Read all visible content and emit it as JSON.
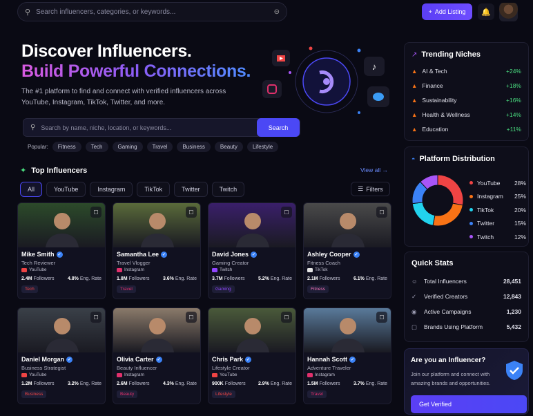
{
  "topbar": {
    "search_placeholder": "Search influencers, categories, or keywords...",
    "add_label": "Add Listing"
  },
  "hero": {
    "title1": "Discover Influencers.",
    "title2": "Build Powerful Connections.",
    "subtitle": "The #1 platform to find and connect with verified influencers across YouTube, Instagram, TikTok, Twitter, and more.",
    "search_placeholder": "Search by name, niche, location, or keywords...",
    "search_btn": "Search",
    "popular_label": "Popular:",
    "popular": [
      "Fitness",
      "Tech",
      "Gaming",
      "Travel",
      "Business",
      "Beauty",
      "Lifestyle"
    ]
  },
  "top": {
    "title": "Top Influencers",
    "view_all": "View all",
    "filters": "Filters",
    "tabs": [
      "All",
      "YouTube",
      "Instagram",
      "TikTok",
      "Twitter",
      "Twitch"
    ]
  },
  "cards": [
    {
      "name": "Mike Smith",
      "role": "Tech Reviewer",
      "platform": "YouTube",
      "followers": "2.4M",
      "eng": "4.8%",
      "tag": "Tech",
      "pc": "#ef4444",
      "photo": "#2c4a2a"
    },
    {
      "name": "Samantha Lee",
      "role": "Travel Vlogger",
      "platform": "Instagram",
      "followers": "1.8M",
      "eng": "3.6%",
      "tag": "Travel",
      "pc": "#e1306c",
      "photo": "#5a6a3a"
    },
    {
      "name": "David Jones",
      "role": "Gaming Creator",
      "platform": "Twitch",
      "followers": "3.7M",
      "eng": "5.2%",
      "tag": "Gaming",
      "pc": "#9146ff",
      "photo": "#3a1f6a"
    },
    {
      "name": "Ashley Cooper",
      "role": "Fitness Coach",
      "platform": "TikTok",
      "followers": "2.1M",
      "eng": "6.1%",
      "tag": "Fitness",
      "pc": "#e5e5e5",
      "photo": "#4a4a4a"
    },
    {
      "name": "Daniel Morgan",
      "role": "Business Strategist",
      "platform": "YouTube",
      "followers": "1.2M",
      "eng": "3.2%",
      "tag": "Business",
      "pc": "#ef4444",
      "photo": "#3a4048"
    },
    {
      "name": "Olivia Carter",
      "role": "Beauty Influencer",
      "platform": "Instagram",
      "followers": "2.6M",
      "eng": "4.3%",
      "tag": "Beauty",
      "pc": "#e1306c",
      "photo": "#8a7a6a"
    },
    {
      "name": "Chris Park",
      "role": "Lifestyle Creator",
      "platform": "YouTube",
      "followers": "900K",
      "eng": "2.9%",
      "tag": "Lifestyle",
      "pc": "#ef4444",
      "photo": "#4a5a3a"
    },
    {
      "name": "Hannah Scott",
      "role": "Adventure Traveler",
      "platform": "Instagram",
      "followers": "1.5M",
      "eng": "3.7%",
      "tag": "Travel",
      "pc": "#e1306c",
      "photo": "#5a7a9a"
    }
  ],
  "labels": {
    "followers": "Followers",
    "eng": "Eng. Rate"
  },
  "trending": {
    "title": "Trending Niches",
    "items": [
      {
        "label": "AI & Tech",
        "pct": "+24%"
      },
      {
        "label": "Finance",
        "pct": "+18%"
      },
      {
        "label": "Sustainability",
        "pct": "+16%"
      },
      {
        "label": "Health & Wellness",
        "pct": "+14%"
      },
      {
        "label": "Education",
        "pct": "+11%"
      }
    ]
  },
  "distribution": {
    "title": "Platform Distribution",
    "items": [
      {
        "label": "YouTube",
        "pct": "28%",
        "value": 28,
        "color": "#ef4444"
      },
      {
        "label": "Instagram",
        "pct": "25%",
        "value": 25,
        "color": "#f97316"
      },
      {
        "label": "TikTok",
        "pct": "20%",
        "value": 20,
        "color": "#22d3ee"
      },
      {
        "label": "Twitter",
        "pct": "15%",
        "value": 15,
        "color": "#3b82f6"
      },
      {
        "label": "Twitch",
        "pct": "12%",
        "value": 12,
        "color": "#a855f7"
      }
    ]
  },
  "quick": {
    "title": "Quick Stats",
    "items": [
      {
        "label": "Total Influencers",
        "value": "28,451"
      },
      {
        "label": "Verified Creators",
        "value": "12,843"
      },
      {
        "label": "Active Campaigns",
        "value": "1,230"
      },
      {
        "label": "Brands Using Platform",
        "value": "5,432"
      }
    ]
  },
  "cta": {
    "title": "Are you an Influencer?",
    "text": "Join our platform and connect with amazing brands and opportunities.",
    "btn": "Get Verified"
  }
}
